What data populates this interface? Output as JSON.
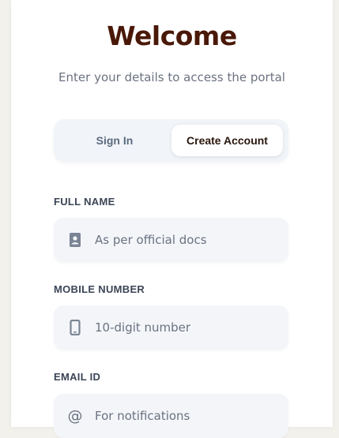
{
  "header": {
    "title": "Welcome",
    "subtitle": "Enter your details to access the portal"
  },
  "tabs": [
    {
      "label": "Sign In",
      "active": false
    },
    {
      "label": "Create Account",
      "active": true
    }
  ],
  "form": {
    "full_name": {
      "label": "FULL NAME",
      "placeholder": "As per official docs",
      "value": "",
      "icon": "id-card-icon"
    },
    "mobile": {
      "label": "MOBILE NUMBER",
      "placeholder": "10-digit number",
      "value": "",
      "icon": "phone-icon"
    },
    "email": {
      "label": "EMAIL ID",
      "placeholder": "For notifications",
      "value": "",
      "icon": "at-icon"
    }
  },
  "colors": {
    "title": "#4a1808",
    "page_background": "#f3f1ec",
    "field_background": "#f3f5f9",
    "tab_active_text": "#2a160c",
    "tab_inactive_text": "#5b6b80"
  }
}
